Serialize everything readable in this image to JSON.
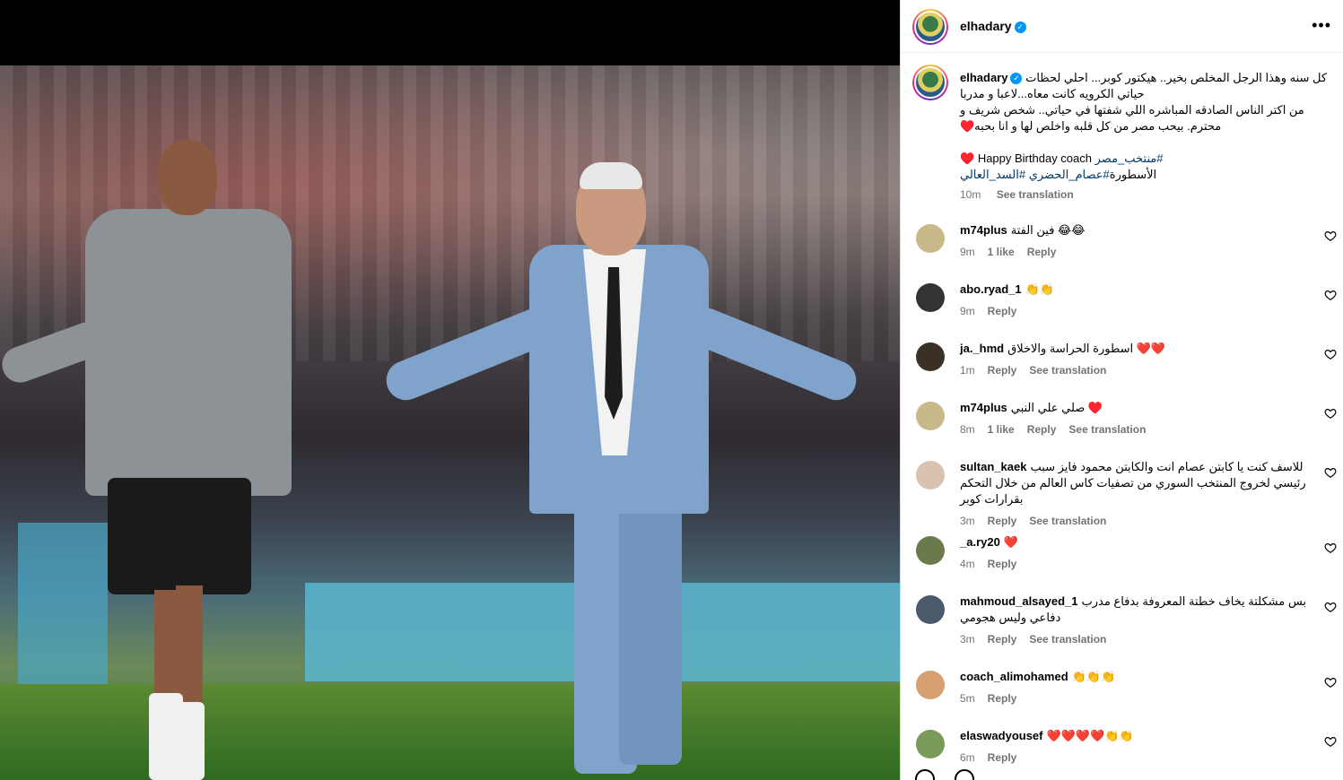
{
  "post": {
    "username": "elhadary",
    "verified_mark": "✓",
    "more_icon": "•••"
  },
  "caption": {
    "username": "elhadary",
    "line1": "كل سنه وهذا الرجل المخلص بخير.. هيكتور كوبر... احلي لحظات حياتي الكرويه كانت معاه...لاعبا و مدربا",
    "line2": "من اكتر الناس الصادقه المباشره اللي شفتها في حياتي.. شخص شريف و محترم. بيحب مصر من كل قلبه واخلص لها و انا بحبه♥️",
    "line3_text": "Happy Birthday coach ♥️",
    "line3_tag": "#منتخب_مصر",
    "line4_prefix": "الأسطورة",
    "line4_tag1": "#عصام_الحضري",
    "line4_tag2": "#السد_العالي",
    "time": "10m",
    "see_translation": "See translation"
  },
  "comments": [
    {
      "user": "m74plus",
      "text": "فين الفتة 😂😂",
      "time": "9m",
      "likes": "1 like",
      "reply": "Reply",
      "translation": ""
    },
    {
      "user": "abo.ryad_1",
      "text": "👏👏",
      "time": "9m",
      "likes": "",
      "reply": "Reply",
      "translation": ""
    },
    {
      "user": "ja._hmd",
      "text": "اسطورة الحراسة والاخلاق ❤️❤️",
      "time": "1m",
      "likes": "",
      "reply": "Reply",
      "translation": "See translation"
    },
    {
      "user": "m74plus",
      "text": "صلي علي النبي ♥️",
      "time": "8m",
      "likes": "1 like",
      "reply": "Reply",
      "translation": "See translation"
    },
    {
      "user": "sultan_kaek",
      "text": "للاسف كنت يا كابتن عصام انت والكابتن محمود فايز سبب رئيسي لخروج المنتخب السوري من تصفيات كاس العالم من خلال التحكم بقرارات كوبر",
      "time": "3m",
      "likes": "",
      "reply": "Reply",
      "translation": "See translation"
    },
    {
      "user": "_a.ry20",
      "text": "❤️",
      "time": "4m",
      "likes": "",
      "reply": "Reply",
      "translation": ""
    },
    {
      "user": "mahmoud_alsayed_1",
      "text": "بس مشكلتة يخاف خطتة المعروفة بدفاع مدرب دفاعي وليس هجومي",
      "time": "3m",
      "likes": "",
      "reply": "Reply",
      "translation": "See translation"
    },
    {
      "user": "coach_alimohamed",
      "text": "👏👏👏",
      "time": "5m",
      "likes": "",
      "reply": "Reply",
      "translation": ""
    },
    {
      "user": "elaswadyousef",
      "text": "❤️❤️❤️❤️👏👏",
      "time": "6m",
      "likes": "",
      "reply": "Reply",
      "translation": ""
    }
  ],
  "colors": {
    "link": "#00376b",
    "meta": "#737373",
    "verified": "#0095f6"
  }
}
